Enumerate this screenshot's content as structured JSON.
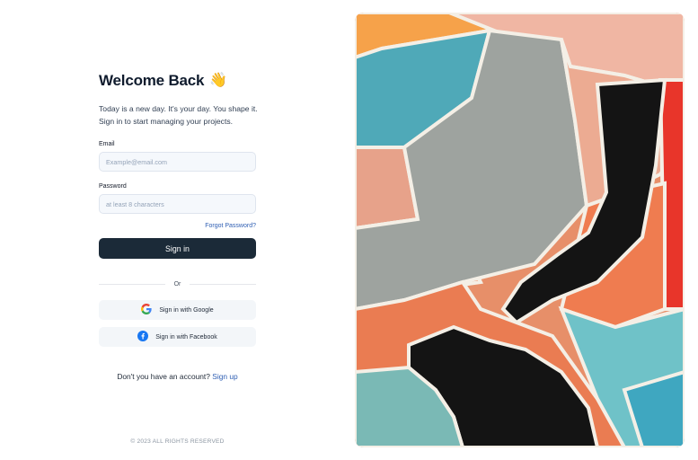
{
  "login": {
    "title": "Welcome Back",
    "wave_emoji": "👋",
    "subtitle": "Today is a new day. It's your day. You shape it. Sign in to start managing your projects.",
    "email": {
      "label": "Email",
      "placeholder": "Example@email.com",
      "value": ""
    },
    "password": {
      "label": "Password",
      "placeholder": "at least 8 characters",
      "value": ""
    },
    "forgot_label": "Forgot Password?",
    "signin_label": "Sign in",
    "divider_label": "Or",
    "google_label": "Sign in with Google",
    "facebook_label": "Sign in with Facebook",
    "signup_prompt": "Don't you have an account?",
    "signup_link": "Sign up",
    "footer": "© 2023 ALL RIGHTS RESERVED"
  },
  "colors": {
    "primary_button": "#1b2a38",
    "link": "#2f5fb3",
    "input_bg": "#f5f8fc",
    "social_bg": "#f3f6f9"
  },
  "icons": {
    "google": "google-icon",
    "facebook": "facebook-icon"
  },
  "artwork": {
    "description_icon": "abstract-mural-image"
  }
}
